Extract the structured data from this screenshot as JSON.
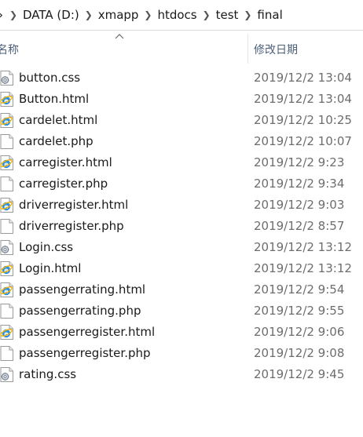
{
  "breadcrumb": {
    "items": [
      "DATA (D:)",
      "xmapp",
      "htdocs",
      "test",
      "final"
    ]
  },
  "columns": {
    "name": "名称",
    "date_modified": "修改日期"
  },
  "colors": {
    "header_text": "#4c607a",
    "date_text": "#6d6d6d",
    "ie_blue": "#1e88e5",
    "ie_ring": "#f5b400"
  },
  "files": [
    {
      "name": "button.css",
      "date": "2019/12/2 13:04",
      "icon": "css-file-icon"
    },
    {
      "name": "Button.html",
      "date": "2019/12/2 13:04",
      "icon": "html-file-icon"
    },
    {
      "name": "cardelet.html",
      "date": "2019/12/2 10:25",
      "icon": "html-file-icon"
    },
    {
      "name": "cardelet.php",
      "date": "2019/12/2 10:07",
      "icon": "blank-file-icon"
    },
    {
      "name": "carregister.html",
      "date": "2019/12/2 9:23",
      "icon": "html-file-icon"
    },
    {
      "name": "carregister.php",
      "date": "2019/12/2 9:34",
      "icon": "blank-file-icon"
    },
    {
      "name": "driverregister.html",
      "date": "2019/12/2 9:03",
      "icon": "html-file-icon"
    },
    {
      "name": "driverregister.php",
      "date": "2019/12/2 8:57",
      "icon": "blank-file-icon"
    },
    {
      "name": "Login.css",
      "date": "2019/12/2 13:12",
      "icon": "css-file-icon"
    },
    {
      "name": "Login.html",
      "date": "2019/12/2 13:12",
      "icon": "html-file-icon"
    },
    {
      "name": "passengerrating.html",
      "date": "2019/12/2 9:54",
      "icon": "html-file-icon"
    },
    {
      "name": "passengerrating.php",
      "date": "2019/12/2 9:55",
      "icon": "blank-file-icon"
    },
    {
      "name": "passengerregister.html",
      "date": "2019/12/2 9:06",
      "icon": "html-file-icon"
    },
    {
      "name": "passengerregister.php",
      "date": "2019/12/2 9:08",
      "icon": "blank-file-icon"
    },
    {
      "name": "rating.css",
      "date": "2019/12/2 9:45",
      "icon": "css-file-icon"
    }
  ]
}
